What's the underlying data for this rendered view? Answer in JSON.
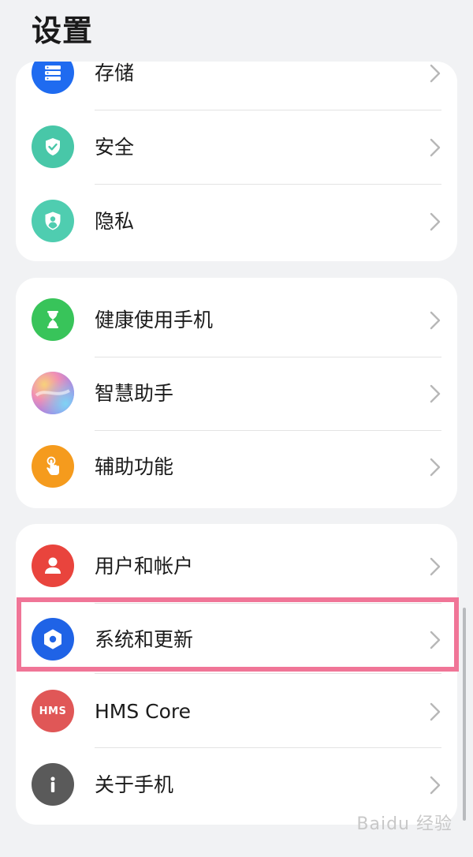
{
  "header": {
    "title": "设置"
  },
  "groups": [
    {
      "items": [
        {
          "label": "存储",
          "icon": "storage-icon",
          "color": "#1f6bf0"
        },
        {
          "label": "安全",
          "icon": "shield-check-icon",
          "color": "#48c7a8"
        },
        {
          "label": "隐私",
          "icon": "privacy-shield-icon",
          "color": "#4fcdb0"
        }
      ]
    },
    {
      "items": [
        {
          "label": "健康使用手机",
          "icon": "hourglass-icon",
          "color": "#38c45a"
        },
        {
          "label": "智慧助手",
          "icon": "assistant-orb-icon",
          "color": "#b99cf2"
        },
        {
          "label": "辅助功能",
          "icon": "hand-touch-icon",
          "color": "#f59b1d"
        }
      ]
    },
    {
      "items": [
        {
          "label": "用户和帐户",
          "icon": "user-icon",
          "color": "#e9443d"
        },
        {
          "label": "系统和更新",
          "icon": "settings-gear-icon",
          "color": "#1f63e6"
        },
        {
          "label": "HMS Core",
          "icon": "hms-icon",
          "color": "#e05757",
          "icon_text": "HMS"
        },
        {
          "label": "关于手机",
          "icon": "info-icon",
          "color": "#5a5a5a"
        }
      ]
    }
  ],
  "highlighted_item": "系统和更新",
  "watermark": "Baidu 经验"
}
